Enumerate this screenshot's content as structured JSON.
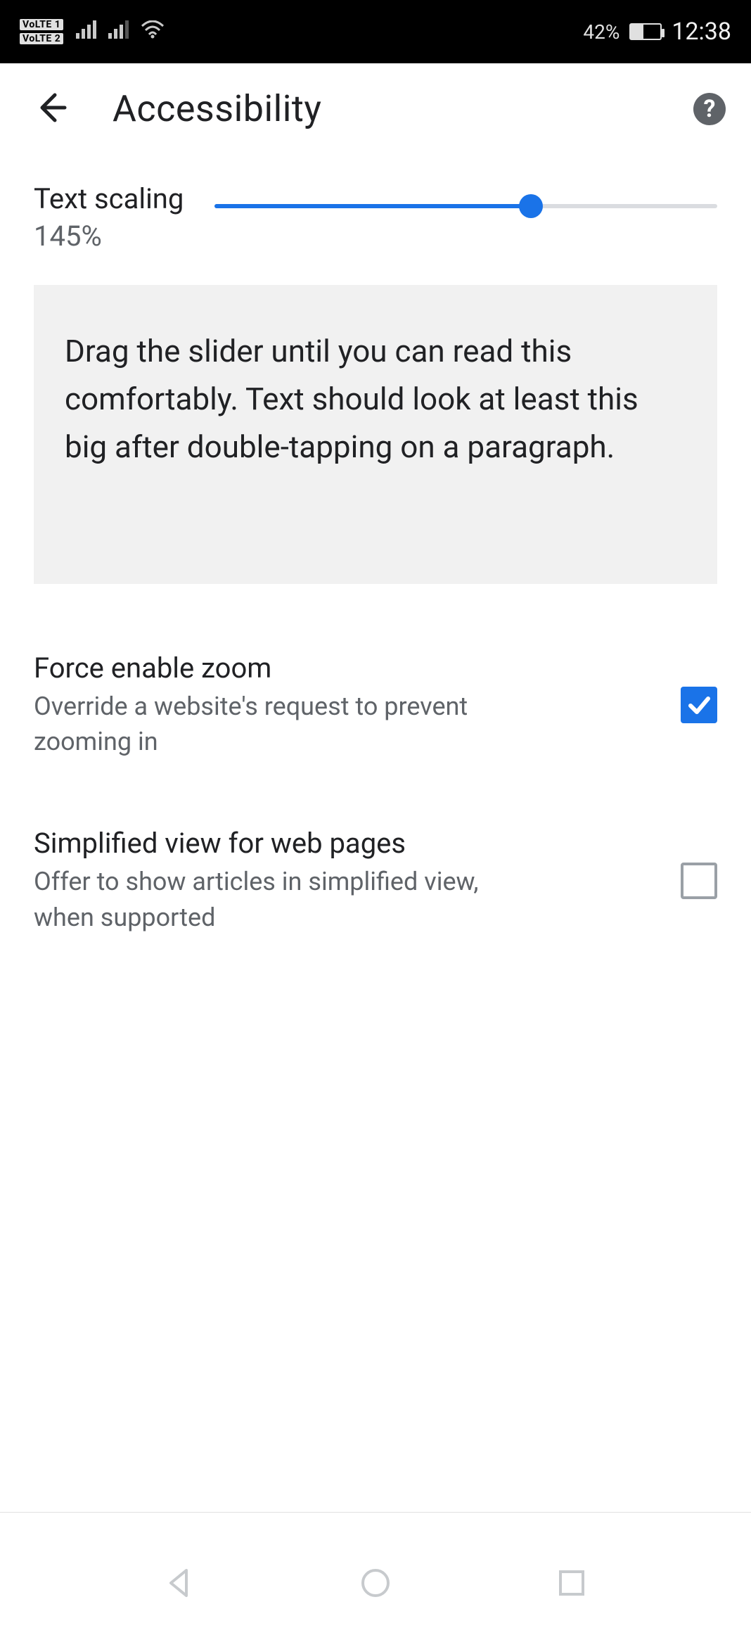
{
  "status": {
    "volte1": "VoLTE 1",
    "volte2": "VoLTE 2",
    "battery_pct": "42%",
    "clock": "12:38"
  },
  "appbar": {
    "title": "Accessibility"
  },
  "scaling": {
    "label": "Text scaling",
    "value": "145%",
    "slider_percent": 63,
    "preview": "Drag the slider until you can read this comfortably. Text should look at least this big after double-tapping on a paragraph."
  },
  "settings": {
    "force_zoom": {
      "title": "Force enable zoom",
      "sub": "Override a website's request to prevent zooming in",
      "checked": true
    },
    "simplified": {
      "title": "Simplified view for web pages",
      "sub": "Offer to show articles in simplified view, when supported",
      "checked": false
    }
  }
}
